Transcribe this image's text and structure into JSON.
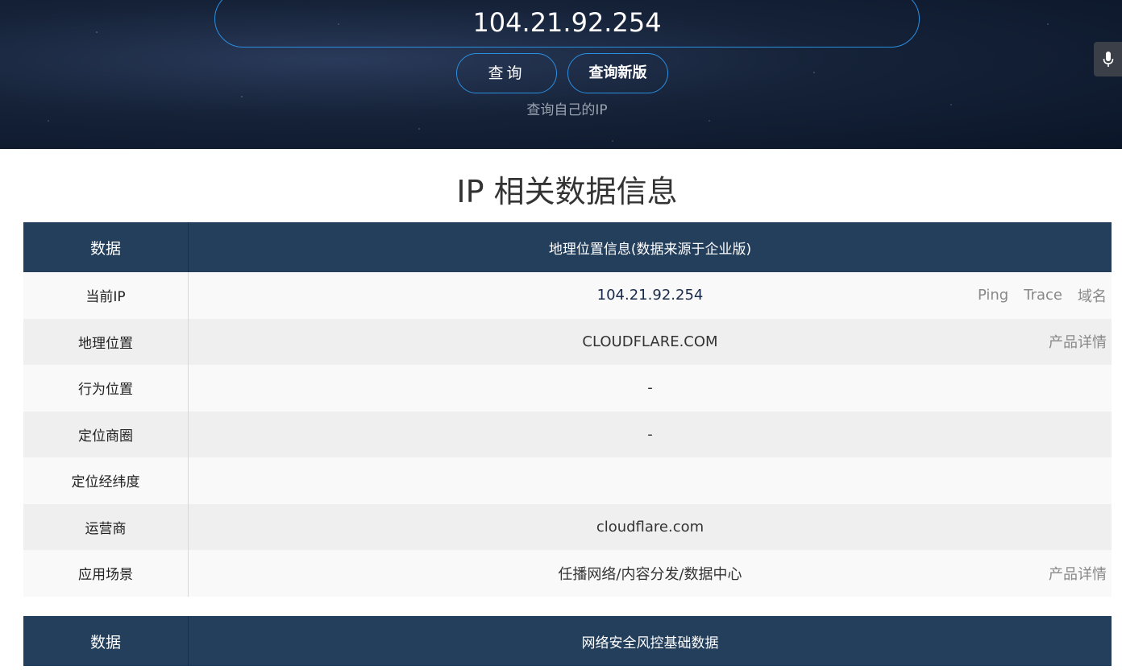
{
  "search": {
    "ip_value": "104.21.92.254",
    "query_label": "查询",
    "query_new_label": "查询新版",
    "self_ip_link": "查询自己的IP"
  },
  "section_title": "IP 相关数据信息",
  "table1": {
    "header_col1": "数据",
    "header_col2": "地理位置信息(数据来源于企业版)",
    "rows": [
      {
        "label": "当前IP",
        "value": "104.21.92.254",
        "actions": [
          "Ping",
          "Trace",
          "域名"
        ]
      },
      {
        "label": "地理位置",
        "value": "CLOUDFLARE.COM",
        "actions": [
          "产品详情"
        ]
      },
      {
        "label": "行为位置",
        "value": "-",
        "actions": []
      },
      {
        "label": "定位商圈",
        "value": "-",
        "actions": []
      },
      {
        "label": "定位经纬度",
        "value": "",
        "actions": []
      },
      {
        "label": "运营商",
        "value": "cloudflare.com",
        "actions": []
      },
      {
        "label": "应用场景",
        "value": "任播网络/内容分发/数据中心",
        "actions": [
          "产品详情"
        ]
      }
    ]
  },
  "table2": {
    "header_col1": "数据",
    "header_col2": "网络安全风控基础数据"
  },
  "colors": {
    "header_bg": "#243f5c",
    "button_border": "#2a8fe0",
    "row_light": "#f9f9f9",
    "row_dark": "#efefef"
  }
}
